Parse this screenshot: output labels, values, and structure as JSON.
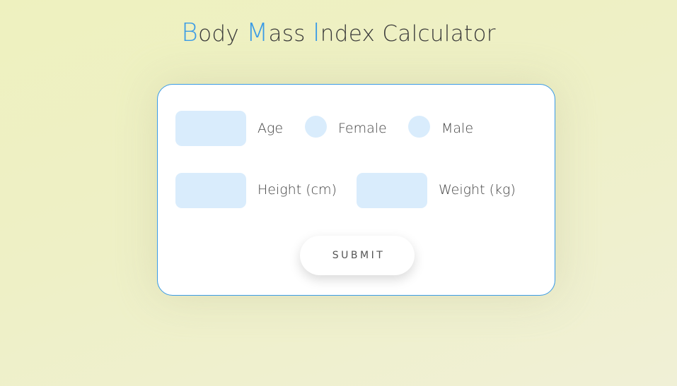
{
  "title": {
    "b_cap": "B",
    "b_rest": "ody ",
    "m_cap": "M",
    "m_rest": "ass ",
    "i_cap": "I",
    "i_rest": "ndex Calculator"
  },
  "form": {
    "age": {
      "label": "Age",
      "value": ""
    },
    "gender": {
      "female_label": "Female",
      "male_label": "Male",
      "selected": null
    },
    "height": {
      "label": "Height (cm)",
      "value": ""
    },
    "weight": {
      "label": "Weight (kg)",
      "value": ""
    },
    "submit_label": "SUBMIT"
  },
  "colors": {
    "accent": "#3a9be6",
    "input_fill": "#d9ecfc",
    "background": "#eef1bf"
  }
}
